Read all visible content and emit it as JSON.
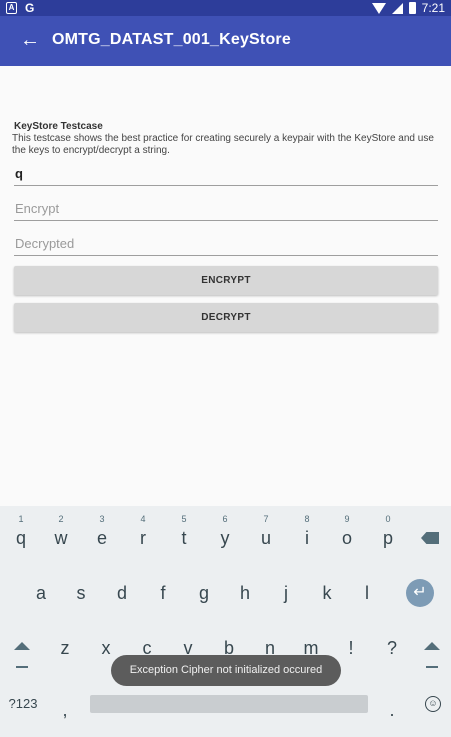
{
  "status_bar": {
    "left_icons": [
      "a-icon",
      "g-icon"
    ],
    "g_glyph": "G",
    "a_glyph": "A",
    "time": "7:21"
  },
  "app_bar": {
    "back_glyph": "←",
    "title": "OMTG_DATAST_001_KeyStore"
  },
  "content": {
    "testcase_title": "KeyStore Testcase",
    "testcase_description": "This testcase shows the best practice for creating securely a keypair with the KeyStore and use the keys to encrypt/decrypt a string.",
    "input_value": "q",
    "encrypt_placeholder": "Encrypt",
    "decrypted_placeholder": "Decrypted",
    "encrypt_button": "ENCRYPT",
    "decrypt_button": "DECRYPT"
  },
  "keyboard": {
    "row1": [
      {
        "key": "q",
        "hint": "1"
      },
      {
        "key": "w",
        "hint": "2"
      },
      {
        "key": "e",
        "hint": "3"
      },
      {
        "key": "r",
        "hint": "4"
      },
      {
        "key": "t",
        "hint": "5"
      },
      {
        "key": "y",
        "hint": "6"
      },
      {
        "key": "u",
        "hint": "7"
      },
      {
        "key": "i",
        "hint": "8"
      },
      {
        "key": "o",
        "hint": "9"
      },
      {
        "key": "p",
        "hint": "0"
      }
    ],
    "row2": [
      "a",
      "s",
      "d",
      "f",
      "g",
      "h",
      "j",
      "k",
      "l"
    ],
    "row3": [
      "z",
      "x",
      "c",
      "v",
      "b",
      "n",
      "m",
      "!",
      "?"
    ],
    "symbols_key": "?123",
    "comma_key": ",",
    "period_key": ".",
    "enter_glyph": "↵",
    "emoji_glyph": "☺"
  },
  "toast": {
    "message": "Exception Cipher not initialized occured"
  },
  "colors": {
    "status_bar": "#2d3d9a",
    "app_bar": "#3f51b5",
    "button_bg": "#d7d7d7",
    "keyboard_bg": "#eceff1",
    "toast_bg": "#5c5c5c"
  }
}
